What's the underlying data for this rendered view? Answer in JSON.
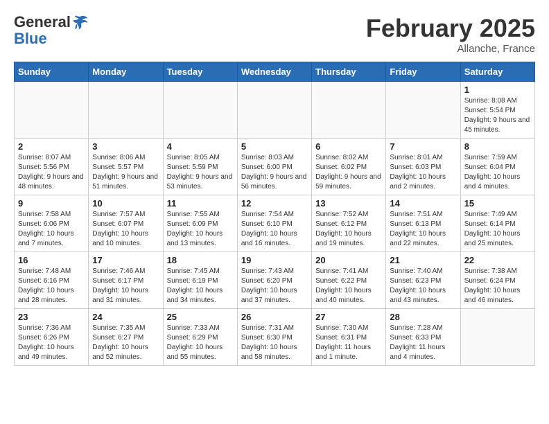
{
  "header": {
    "logo_general": "General",
    "logo_blue": "Blue",
    "month": "February 2025",
    "location": "Allanche, France"
  },
  "days_of_week": [
    "Sunday",
    "Monday",
    "Tuesday",
    "Wednesday",
    "Thursday",
    "Friday",
    "Saturday"
  ],
  "weeks": [
    [
      {
        "day": "",
        "info": ""
      },
      {
        "day": "",
        "info": ""
      },
      {
        "day": "",
        "info": ""
      },
      {
        "day": "",
        "info": ""
      },
      {
        "day": "",
        "info": ""
      },
      {
        "day": "",
        "info": ""
      },
      {
        "day": "1",
        "info": "Sunrise: 8:08 AM\nSunset: 5:54 PM\nDaylight: 9 hours and 45 minutes."
      }
    ],
    [
      {
        "day": "2",
        "info": "Sunrise: 8:07 AM\nSunset: 5:56 PM\nDaylight: 9 hours and 48 minutes."
      },
      {
        "day": "3",
        "info": "Sunrise: 8:06 AM\nSunset: 5:57 PM\nDaylight: 9 hours and 51 minutes."
      },
      {
        "day": "4",
        "info": "Sunrise: 8:05 AM\nSunset: 5:59 PM\nDaylight: 9 hours and 53 minutes."
      },
      {
        "day": "5",
        "info": "Sunrise: 8:03 AM\nSunset: 6:00 PM\nDaylight: 9 hours and 56 minutes."
      },
      {
        "day": "6",
        "info": "Sunrise: 8:02 AM\nSunset: 6:02 PM\nDaylight: 9 hours and 59 minutes."
      },
      {
        "day": "7",
        "info": "Sunrise: 8:01 AM\nSunset: 6:03 PM\nDaylight: 10 hours and 2 minutes."
      },
      {
        "day": "8",
        "info": "Sunrise: 7:59 AM\nSunset: 6:04 PM\nDaylight: 10 hours and 4 minutes."
      }
    ],
    [
      {
        "day": "9",
        "info": "Sunrise: 7:58 AM\nSunset: 6:06 PM\nDaylight: 10 hours and 7 minutes."
      },
      {
        "day": "10",
        "info": "Sunrise: 7:57 AM\nSunset: 6:07 PM\nDaylight: 10 hours and 10 minutes."
      },
      {
        "day": "11",
        "info": "Sunrise: 7:55 AM\nSunset: 6:09 PM\nDaylight: 10 hours and 13 minutes."
      },
      {
        "day": "12",
        "info": "Sunrise: 7:54 AM\nSunset: 6:10 PM\nDaylight: 10 hours and 16 minutes."
      },
      {
        "day": "13",
        "info": "Sunrise: 7:52 AM\nSunset: 6:12 PM\nDaylight: 10 hours and 19 minutes."
      },
      {
        "day": "14",
        "info": "Sunrise: 7:51 AM\nSunset: 6:13 PM\nDaylight: 10 hours and 22 minutes."
      },
      {
        "day": "15",
        "info": "Sunrise: 7:49 AM\nSunset: 6:14 PM\nDaylight: 10 hours and 25 minutes."
      }
    ],
    [
      {
        "day": "16",
        "info": "Sunrise: 7:48 AM\nSunset: 6:16 PM\nDaylight: 10 hours and 28 minutes."
      },
      {
        "day": "17",
        "info": "Sunrise: 7:46 AM\nSunset: 6:17 PM\nDaylight: 10 hours and 31 minutes."
      },
      {
        "day": "18",
        "info": "Sunrise: 7:45 AM\nSunset: 6:19 PM\nDaylight: 10 hours and 34 minutes."
      },
      {
        "day": "19",
        "info": "Sunrise: 7:43 AM\nSunset: 6:20 PM\nDaylight: 10 hours and 37 minutes."
      },
      {
        "day": "20",
        "info": "Sunrise: 7:41 AM\nSunset: 6:22 PM\nDaylight: 10 hours and 40 minutes."
      },
      {
        "day": "21",
        "info": "Sunrise: 7:40 AM\nSunset: 6:23 PM\nDaylight: 10 hours and 43 minutes."
      },
      {
        "day": "22",
        "info": "Sunrise: 7:38 AM\nSunset: 6:24 PM\nDaylight: 10 hours and 46 minutes."
      }
    ],
    [
      {
        "day": "23",
        "info": "Sunrise: 7:36 AM\nSunset: 6:26 PM\nDaylight: 10 hours and 49 minutes."
      },
      {
        "day": "24",
        "info": "Sunrise: 7:35 AM\nSunset: 6:27 PM\nDaylight: 10 hours and 52 minutes."
      },
      {
        "day": "25",
        "info": "Sunrise: 7:33 AM\nSunset: 6:29 PM\nDaylight: 10 hours and 55 minutes."
      },
      {
        "day": "26",
        "info": "Sunrise: 7:31 AM\nSunset: 6:30 PM\nDaylight: 10 hours and 58 minutes."
      },
      {
        "day": "27",
        "info": "Sunrise: 7:30 AM\nSunset: 6:31 PM\nDaylight: 11 hours and 1 minute."
      },
      {
        "day": "28",
        "info": "Sunrise: 7:28 AM\nSunset: 6:33 PM\nDaylight: 11 hours and 4 minutes."
      },
      {
        "day": "",
        "info": ""
      }
    ]
  ]
}
